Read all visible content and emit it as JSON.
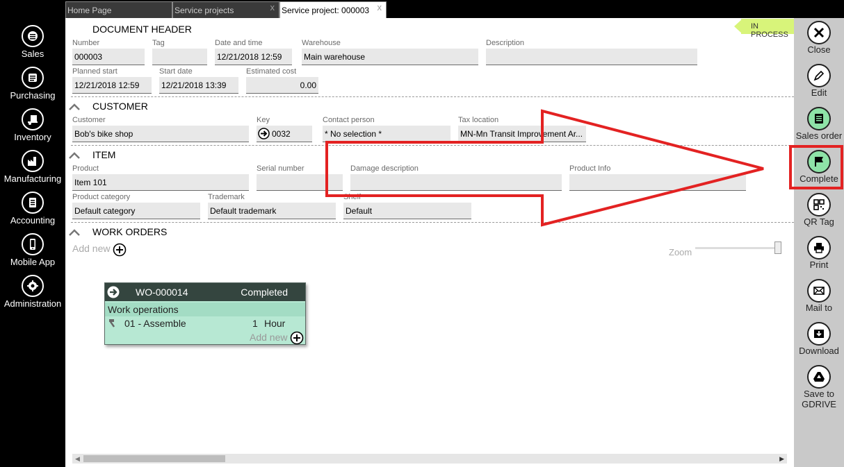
{
  "nav": [
    {
      "label": "Sales",
      "icon": "sales-icon"
    },
    {
      "label": "Purchasing",
      "icon": "purchasing-icon"
    },
    {
      "label": "Inventory",
      "icon": "inventory-icon"
    },
    {
      "label": "Manufacturing",
      "icon": "manufacturing-icon"
    },
    {
      "label": "Accounting",
      "icon": "accounting-icon"
    },
    {
      "label": "Mobile App",
      "icon": "mobile-icon"
    },
    {
      "label": "Administration",
      "icon": "administration-icon"
    }
  ],
  "tabs": [
    {
      "label": "Home Page"
    },
    {
      "label": "Service projects",
      "close": "x"
    },
    {
      "label": "Service project: 000003",
      "close": "x"
    }
  ],
  "status": "IN PROCESS",
  "header": {
    "title": "DOCUMENT HEADER",
    "number_label": "Number",
    "number": "000003",
    "tag_label": "Tag",
    "tag": "",
    "datetime_label": "Date and time",
    "datetime": "12/21/2018 12:59",
    "warehouse_label": "Warehouse",
    "warehouse": "Main warehouse",
    "description_label": "Description",
    "description": "",
    "planned_start_label": "Planned start",
    "planned_start": "12/21/2018 12:59",
    "start_date_label": "Start date",
    "start_date": "12/21/2018 13:39",
    "estimated_cost_label": "Estimated cost",
    "estimated_cost": "0.00"
  },
  "customer": {
    "title": "CUSTOMER",
    "customer_label": "Customer",
    "customer": "Bob's bike shop",
    "key_label": "Key",
    "key": "0032",
    "contact_label": "Contact person",
    "contact": "* No selection *",
    "tax_label": "Tax location",
    "tax": "MN-Mn Transit Improvement Ar..."
  },
  "item": {
    "title": "ITEM",
    "product_label": "Product",
    "product": "Item 101",
    "serial_label": "Serial number",
    "serial": "",
    "damage_label": "Damage description",
    "damage": "",
    "product_info_label": "Product Info",
    "product_info": "",
    "category_label": "Product category",
    "category": "Default category",
    "trademark_label": "Trademark",
    "trademark": "Default trademark",
    "shelf_label": "Shelf",
    "shelf": "Default"
  },
  "work_orders": {
    "title": "WORK ORDERS",
    "add_new": "Add new",
    "zoom_label": "Zoom",
    "card": {
      "id": "WO-000014",
      "status": "Completed",
      "section": "Work operations",
      "operation": "01 - Assemble",
      "quantity": "1",
      "unit": "Hour",
      "add_new": "Add new"
    }
  },
  "toolbar": [
    {
      "label": "Close",
      "icon": "close-icon"
    },
    {
      "label": "Edit",
      "icon": "edit-icon"
    },
    {
      "label": "Sales order",
      "icon": "sales-order-icon"
    },
    {
      "label": "Complete",
      "icon": "flag-icon"
    },
    {
      "label": "QR Tag",
      "icon": "qr-code-icon"
    },
    {
      "label": "Print",
      "icon": "print-icon"
    },
    {
      "label": "Mail to",
      "icon": "mail-icon"
    },
    {
      "label": "Download",
      "icon": "download-icon"
    },
    {
      "label": "Save to",
      "label2": "GDRIVE",
      "icon": "gdrive-icon"
    }
  ],
  "colors": {
    "nav_bg": "#000000",
    "toolbar_bg": "#c9c9c9",
    "highlight": "#e32222",
    "status_tag": "#d8f47a",
    "card_bg": "#b7e8d3",
    "card_header": "#34453f"
  }
}
